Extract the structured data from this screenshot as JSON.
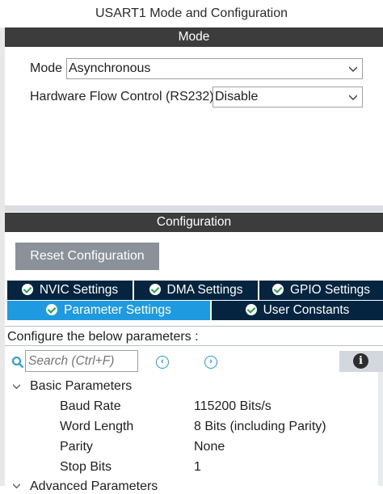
{
  "window": {
    "title": "USART1 Mode and Configuration"
  },
  "mode_section": {
    "header": "Mode",
    "fields": [
      {
        "label": "Mode",
        "value": "Asynchronous"
      },
      {
        "label": "Hardware Flow Control (RS232)",
        "value": "Disable"
      }
    ]
  },
  "config_section": {
    "header": "Configuration",
    "reset_label": "Reset Configuration",
    "tabs_row1": [
      {
        "label": "NVIC Settings"
      },
      {
        "label": "DMA Settings"
      },
      {
        "label": "GPIO Settings"
      }
    ],
    "tabs_row2": [
      {
        "label": "Parameter Settings",
        "active": true
      },
      {
        "label": "User Constants"
      }
    ],
    "instruction": "Configure the below parameters :",
    "search": {
      "placeholder": "Search (Ctrl+F)"
    },
    "groups": [
      {
        "name": "Basic Parameters",
        "params": [
          {
            "name": "Baud Rate",
            "value": "115200 Bits/s"
          },
          {
            "name": "Word Length",
            "value": "8 Bits (including Parity)"
          },
          {
            "name": "Parity",
            "value": "None"
          },
          {
            "name": "Stop Bits",
            "value": "1"
          }
        ]
      },
      {
        "name": "Advanced Parameters"
      }
    ]
  },
  "icons": {
    "search": "search-icon",
    "prev": "chevron-left-circle-icon",
    "next": "chevron-right-circle-icon",
    "info": "info-icon"
  },
  "colors": {
    "section_header": "#3c3c3c",
    "tab_inactive": "#05243f",
    "tab_active": "#1e9be0",
    "check": "#2aa14a",
    "reset_button": "#8a9199"
  }
}
